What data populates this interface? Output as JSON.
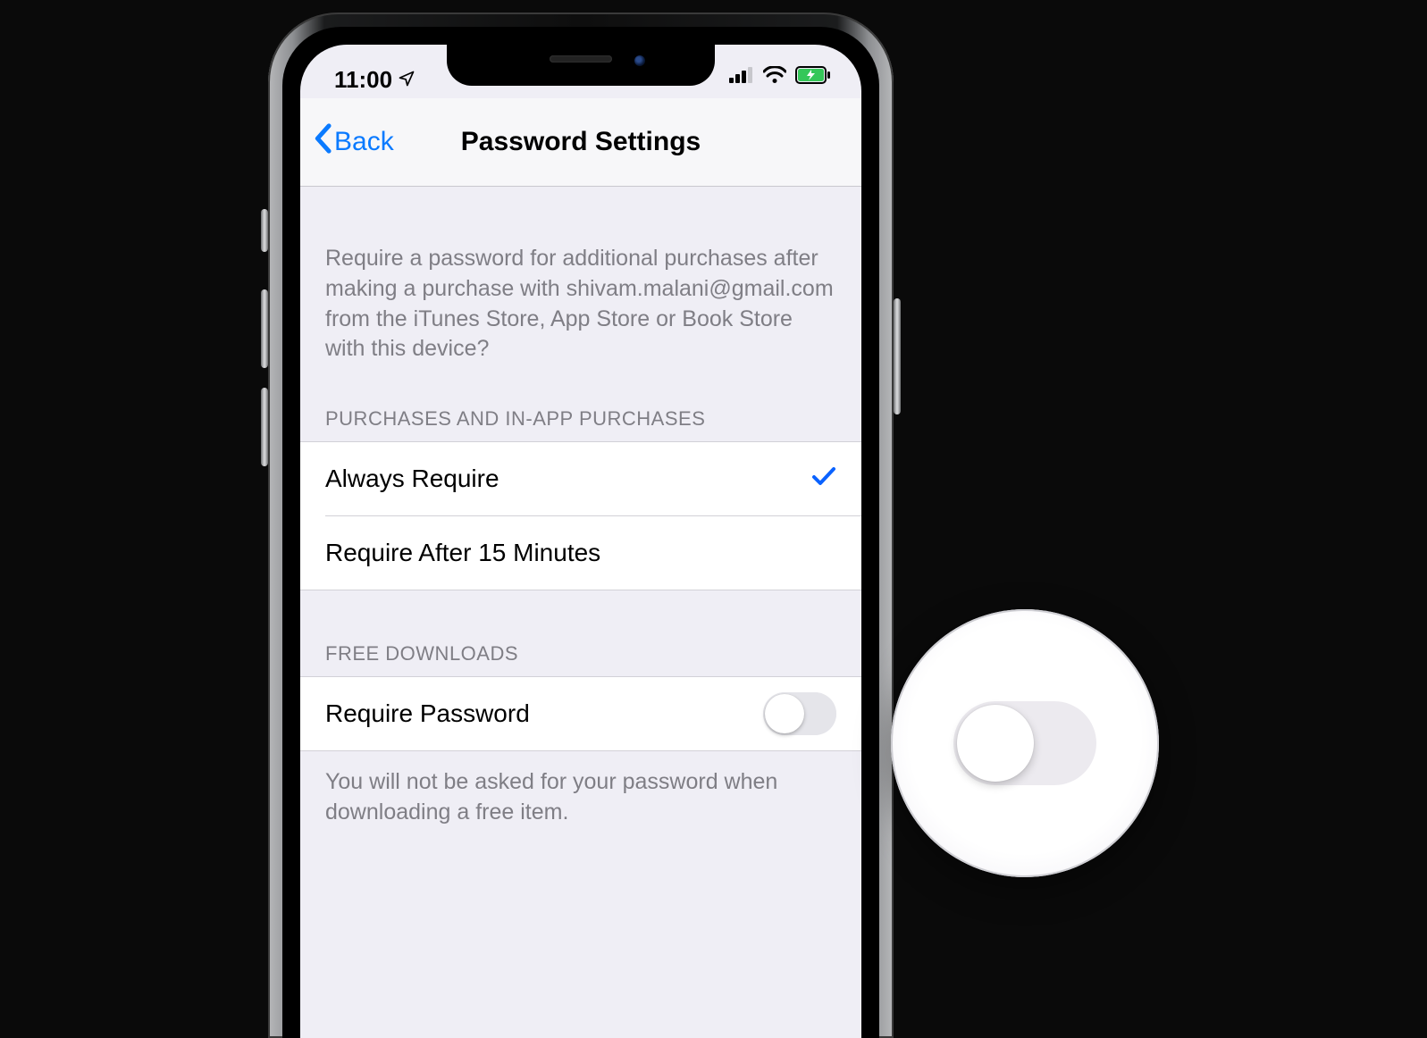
{
  "status": {
    "time": "11:00"
  },
  "nav": {
    "back_label": "Back",
    "title": "Password Settings"
  },
  "description_text": "Require a password for additional purchases after making a purchase with shivam.malani@gmail.com from the iTunes Store, App Store or Book Store with this device?",
  "groups": {
    "purchases": {
      "header": "PURCHASES AND IN-APP PURCHASES",
      "options": [
        {
          "label": "Always Require",
          "selected": true
        },
        {
          "label": "Require After 15 Minutes",
          "selected": false
        }
      ]
    },
    "free_downloads": {
      "header": "FREE DOWNLOADS",
      "toggle": {
        "label": "Require Password",
        "on": false
      },
      "footer": "You will not be asked for your password when downloading a free item."
    }
  }
}
